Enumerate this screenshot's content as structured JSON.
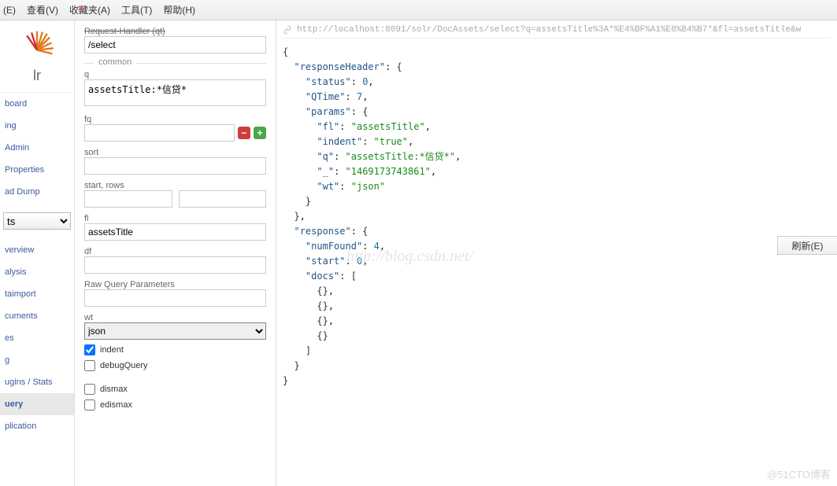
{
  "menu": {
    "items": [
      "(E)",
      "查看(V)",
      "收藏夹(A)",
      "工具(T)",
      "帮助(H)"
    ]
  },
  "logo": {
    "text": "lr"
  },
  "nav": {
    "core_selected": "ts",
    "top": [
      "board",
      "ing",
      "Admin",
      "Properties",
      "ad Dump"
    ],
    "bottom": [
      "verview",
      "alysis",
      "taimport",
      "cuments",
      "es",
      "g",
      "ugins / Stats",
      "uery",
      "plication"
    ],
    "selected_bottom": "uery"
  },
  "form": {
    "reqhandler_label": "Request-Handler (qt)",
    "reqhandler_value": "/select",
    "legend_common": "common",
    "q_label": "q",
    "q_value": "assetsTitle:*信贷*",
    "fq_label": "fq",
    "fq_value": "",
    "sort_label": "sort",
    "sort_value": "",
    "start_rows_label": "start, rows",
    "start_value": "",
    "rows_value": "",
    "fl_label": "fl",
    "fl_value": "assetsTitle",
    "df_label": "df",
    "df_value": "",
    "raw_label": "Raw Query Parameters",
    "raw_value": "",
    "wt_label": "wt",
    "wt_value": "json",
    "indent_label": "indent",
    "indent_checked": true,
    "debug_label": "debugQuery",
    "debug_checked": false,
    "dismax_label": "dismax",
    "dismax_checked": false,
    "edismax_label": "edismax",
    "edismax_checked": false
  },
  "result": {
    "url": "http://localhost:8091/solr/DocAssets/select?q=assetsTitle%3A*%E4%BF%A1%E8%B4%B7*&fl=assetsTitle&w",
    "json": {
      "k_responseHeader": "responseHeader",
      "k_status": "status",
      "v_status": 0,
      "k_QTime": "QTime",
      "v_QTime": 7,
      "k_params": "params",
      "k_fl": "fl",
      "v_fl": "assetsTitle",
      "k_indent": "indent",
      "v_indent": "true",
      "k_q": "q",
      "v_q": "assetsTitle:*信贷*",
      "k_u": "_",
      "v_u": "1469173743861",
      "k_wt": "wt",
      "v_wt": "json",
      "k_response": "response",
      "k_numFound": "numFound",
      "v_numFound": 4,
      "k_start": "start",
      "v_start": 0,
      "k_docs": "docs"
    }
  },
  "refresh_label": "刷新(E)",
  "watermark1": "http://blog.csdn.net/",
  "watermark2": "@51CTO博客"
}
